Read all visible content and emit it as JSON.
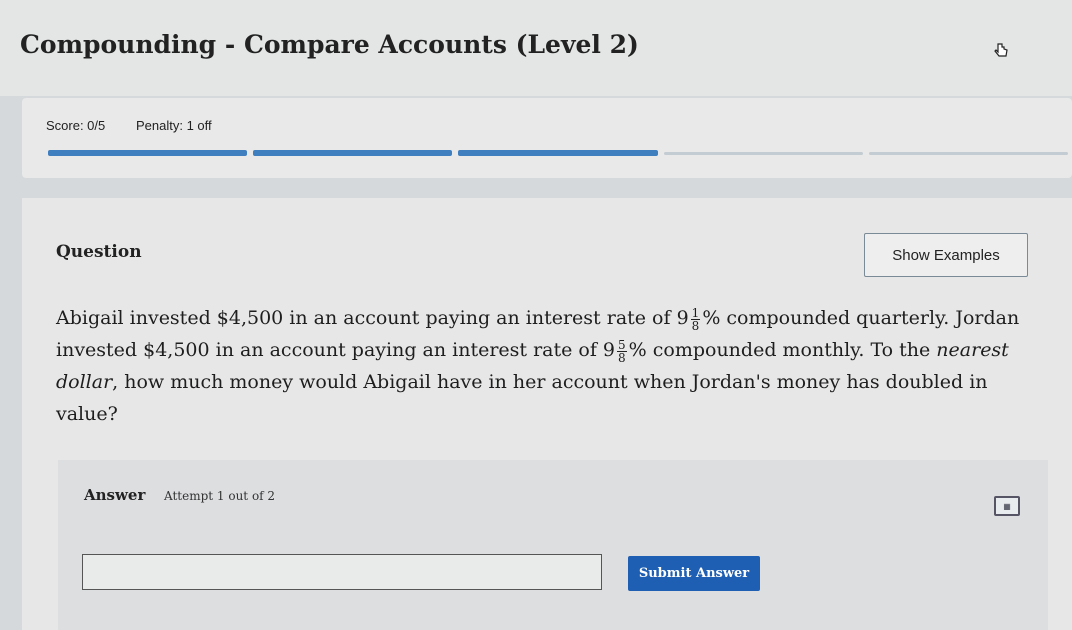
{
  "header": {
    "title": "Compounding - Compare Accounts (Level 2)",
    "cursor_icon": "pointer-hand-icon"
  },
  "score_bar": {
    "score": "Score: 0/5",
    "penalty": "Penalty: 1 off",
    "progress_segments": [
      true,
      true,
      true,
      false,
      false
    ]
  },
  "question": {
    "label": "Question",
    "show_examples": "Show Examples",
    "text_1": "Abigail invested $4,500 in an account paying an interest rate of 9",
    "frac1_num": "1",
    "frac1_den": "8",
    "text_2": "% compounded quarterly. Jordan invested $4,500 in an account paying an interest rate of 9",
    "frac2_num": "5",
    "frac2_den": "8",
    "text_3": "% compounded monthly. To the ",
    "text_italic": "nearest dollar",
    "text_4": ", how much money would Abigail have in her account when Jordan's money has doubled in value?"
  },
  "answer": {
    "label": "Answer",
    "attempt": "Attempt 1 out of 2",
    "calculator_icon": "calculator-icon",
    "input_value": "",
    "submit_label": "Submit Answer"
  },
  "colors": {
    "accent": "#1f5fb3",
    "progress_done": "#3f7fc0",
    "progress_todo": "#c3ccd2"
  }
}
